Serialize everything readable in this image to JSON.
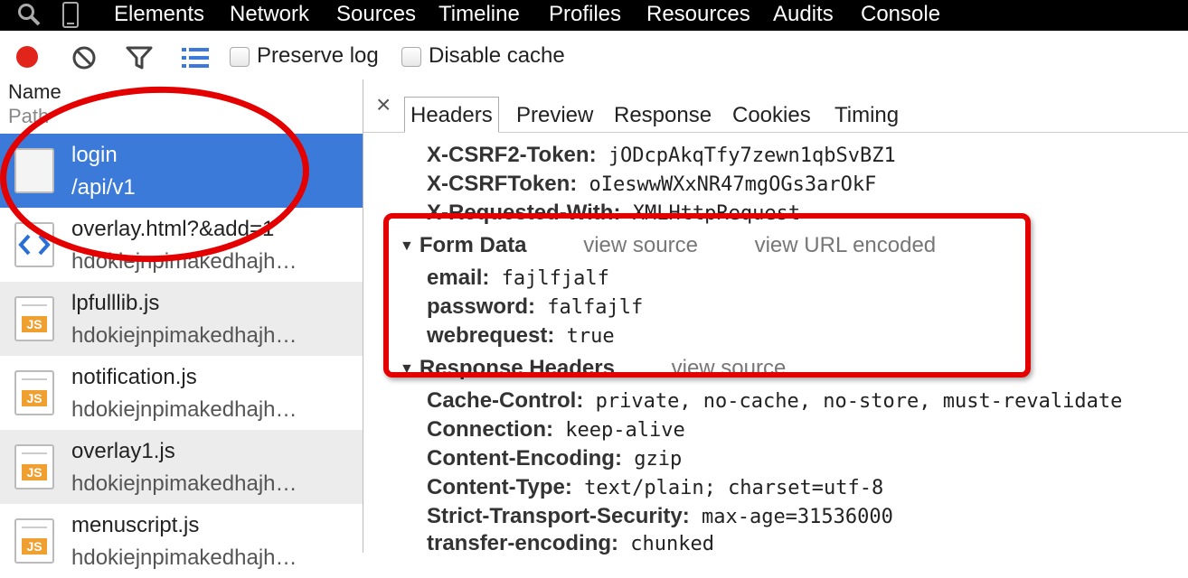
{
  "topbar": {
    "tabs": [
      "Elements",
      "Network",
      "Sources",
      "Timeline",
      "Profiles",
      "Resources",
      "Audits",
      "Console"
    ],
    "icons": [
      "search-icon",
      "device-mode-icon"
    ]
  },
  "toolbar": {
    "record_color": "#e1251b",
    "preserve_log_label": "Preserve log",
    "disable_cache_label": "Disable cache",
    "icons": [
      "record-icon",
      "clear-icon",
      "filter-icon",
      "list-view-icon"
    ]
  },
  "requests": {
    "col_name": "Name",
    "col_path": "Path",
    "rows": [
      {
        "name": "login",
        "path": "/api/v1",
        "icon": "document-icon",
        "selected": true
      },
      {
        "name": "overlay.html?&add=1",
        "path": "hdokiejnpimakedhajh…",
        "icon": "html-file-icon"
      },
      {
        "name": "lpfulllib.js",
        "path": "hdokiejnpimakedhajh…",
        "icon": "js-file-icon"
      },
      {
        "name": "notification.js",
        "path": "hdokiejnpimakedhajh…",
        "icon": "js-file-icon"
      },
      {
        "name": "overlay1.js",
        "path": "hdokiejnpimakedhajh…",
        "icon": "js-file-icon"
      },
      {
        "name": "menuscript.js",
        "path": "hdokiejnpimakedhajh…",
        "icon": "js-file-icon"
      }
    ]
  },
  "details": {
    "close": "×",
    "tabs": [
      "Headers",
      "Preview",
      "Response",
      "Cookies",
      "Timing"
    ],
    "request_headers": [
      {
        "k": "X-CSRF2-Token:",
        "v": "jODcpAkqTfy7zewn1qbSvBZ1"
      },
      {
        "k": "X-CSRFToken:",
        "v": "oIeswwWXxNR47mgOGs3arOkF"
      },
      {
        "k": "X-Requested-With:",
        "v": "XMLHttpRequest"
      }
    ],
    "form_data": {
      "title": "Form Data",
      "view_source": "view source",
      "view_url_encoded": "view URL encoded",
      "fields": [
        {
          "k": "email:",
          "v": "fajlfjalf"
        },
        {
          "k": "password:",
          "v": "falfajlf"
        },
        {
          "k": "webrequest:",
          "v": "true"
        }
      ]
    },
    "response_headers": {
      "title": "Response Headers",
      "view_source": "view source",
      "fields": [
        {
          "k": "Cache-Control:",
          "v": "private, no-cache, no-store, must-revalidate"
        },
        {
          "k": "Connection:",
          "v": "keep-alive"
        },
        {
          "k": "Content-Encoding:",
          "v": "gzip"
        },
        {
          "k": "Content-Type:",
          "v": "text/plain; charset=utf-8"
        },
        {
          "k": "Strict-Transport-Security:",
          "v": "max-age=31536000"
        },
        {
          "k": "transfer-encoding:",
          "v": "chunked"
        }
      ]
    }
  },
  "annotation_color": "#e40000",
  "selection_color": "#3b7ad9"
}
